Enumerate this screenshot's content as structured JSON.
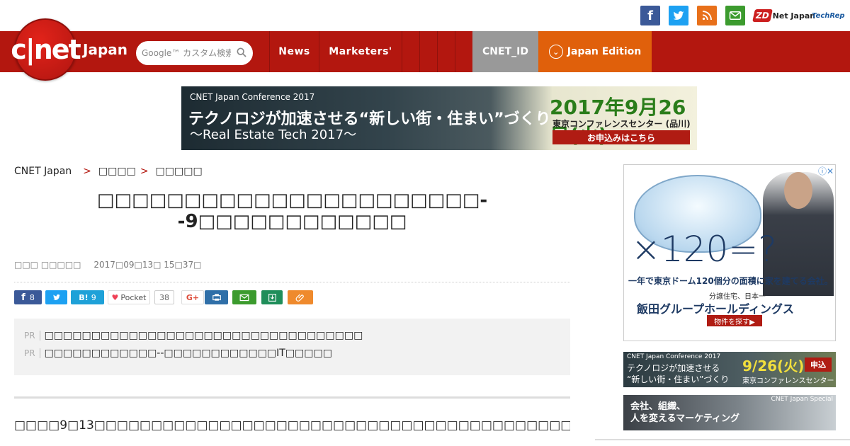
{
  "social": {
    "facebook": "f",
    "twitter": "t",
    "rss": "rss",
    "mail": "mail",
    "zdnet_box": "ZD",
    "zdnet_text": "Net Japan",
    "techrepublic": "TechRep"
  },
  "nav": {
    "logo": "c|net",
    "logo_japan": "Japan",
    "search_placeholder": "Google™ カスタム検索",
    "items": [
      "News",
      "Marketers'"
    ],
    "cnet_id": "CNET_ID",
    "edition": "Japan Edition"
  },
  "banner": {
    "small": "CNET Japan Conference 2017",
    "headline": "テクノロジが加速させる“新しい街・住まい”づくり",
    "sub": "〜Real Estate Tech 2017〜",
    "date": "2017年9月26日(火)",
    "venue": "東京コンファレンスセンター (品川)",
    "button": "お申込みはこちら"
  },
  "breadcrumb": {
    "home": "CNET Japan",
    "sep": ">",
    "level1": "□□□□",
    "level2": "□□□□□"
  },
  "article": {
    "title": "□□□□□□□□□□□□□□□□□□□□□□--9□□□□□□□□□□□□",
    "author": "□□□ □□□□□",
    "date": "2017□09□13□ 15□37□",
    "body": "□□□□9□13□□□□□□□□□□□□□□□□□□□□□□□□□□□□□□□□□□□□□□□□□□□□□□□□□□"
  },
  "share": {
    "fb_count": "8",
    "hatena_label": "B!",
    "hatena_count": "9",
    "pocket_label": "Pocket",
    "pocket_count": "38",
    "gplus_label": "G+"
  },
  "pr": {
    "label": "PR",
    "items": [
      "□□□□□□□□□□□□□□□□□□□□□□□□□□□□□□□□□□",
      "□□□□□□□□□□□□--□□□□□□□□□□□□IT□□□□□"
    ]
  },
  "ads": {
    "ad1": {
      "number": "×120=?",
      "line1": "一年で東京ドーム120個分の面積に家を建てる会社。",
      "line2": "分譲住宅、日本一",
      "line3": "飯田グループホールディングス",
      "button": "物件を探す▶",
      "close": "ⓘ✕"
    },
    "ad2": {
      "small": "CNET Japan Conference 2017",
      "text1": "テクノロジが加速させる",
      "text2": "“新しい街・住まい”づくり",
      "date": "9/26(火)",
      "venue": "東京コンファレンスセンター",
      "button": "申込"
    },
    "ad3": {
      "text1": "会社、組織、",
      "text2": "人を変えるマーケティング",
      "tag": "CNET Japan Special"
    }
  },
  "colors": {
    "nav_red": "#b3170f",
    "id_gray": "#999999",
    "edition_orange": "#e0600b",
    "facebook": "#3b5998",
    "twitter": "#1da1f2",
    "rss": "#e8701a",
    "mail": "#3c9b2e"
  }
}
